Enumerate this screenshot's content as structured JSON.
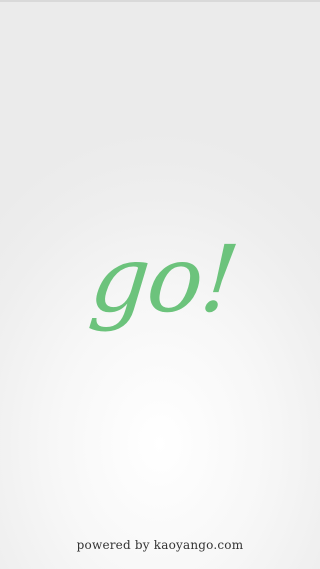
{
  "splash": {
    "logo_text": "go!",
    "footer_text": "powered by kaoyango.com",
    "brand_color": "#6cc37c"
  }
}
